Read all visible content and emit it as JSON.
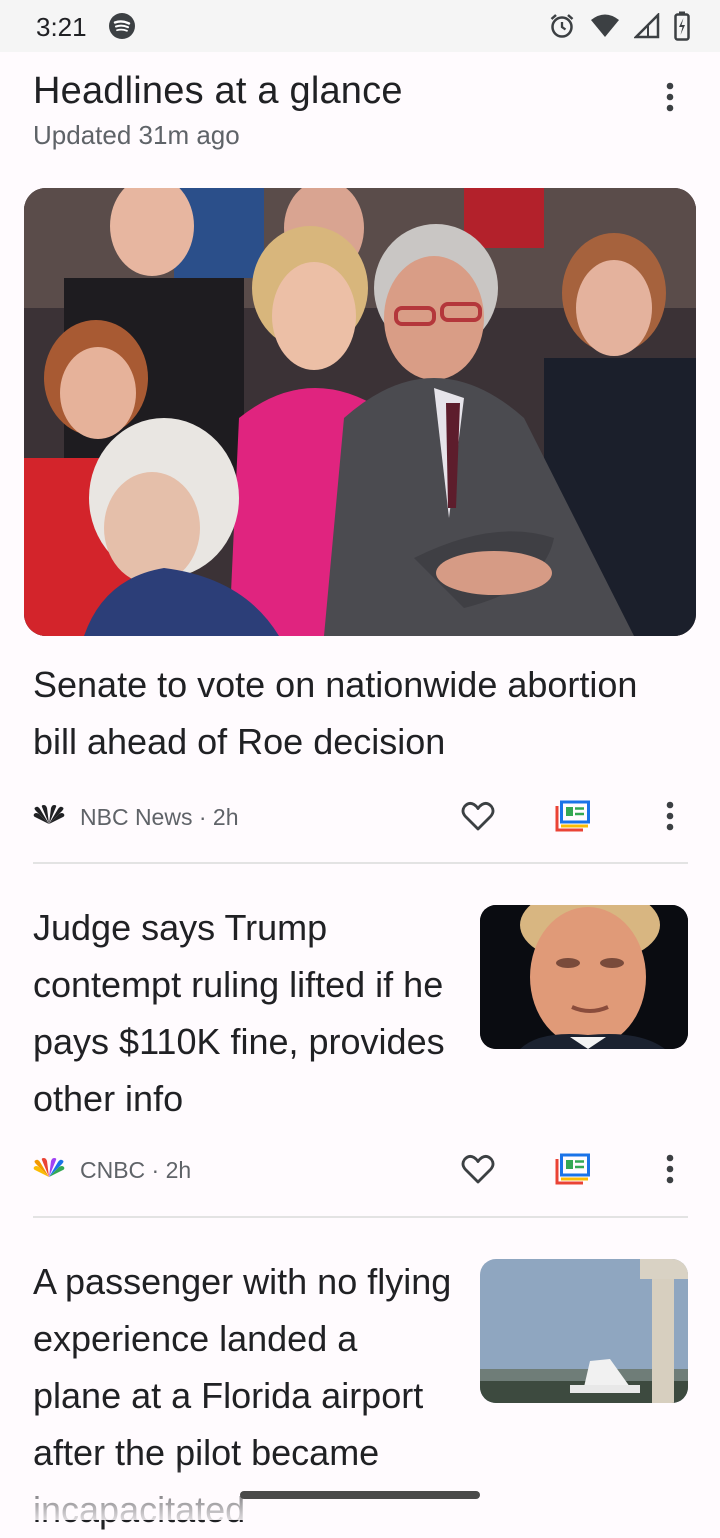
{
  "status_bar": {
    "time": "3:21",
    "icons": [
      "spotify-icon",
      "alarm-icon",
      "wifi-icon",
      "signal-icon",
      "battery-icon"
    ]
  },
  "header": {
    "title": "Headlines at a glance",
    "updated": "Updated 31m ago",
    "menu_icon": "more-vert-icon"
  },
  "stories": [
    {
      "headline": "Senate to vote on nationwide abortion bill ahead of Roe decision",
      "source": "NBC News",
      "age": "2h",
      "meta": "NBC News · 2h",
      "image": "hero-photo"
    },
    {
      "headline": "Judge says Trump contempt ruling lifted if he pays $110K fine, provides other info",
      "source": "CNBC",
      "age": "2h",
      "meta": "CNBC · 2h",
      "image": "thumbnail-photo"
    },
    {
      "headline": "A passenger with no flying experience landed a plane at a Florida airport after the pilot became incapacitated",
      "image": "thumbnail-photo"
    }
  ],
  "actions": {
    "like_icon": "heart-outline-icon",
    "full_coverage_icon": "full-coverage-icon",
    "more_icon": "more-vert-icon"
  },
  "colors": {
    "background": "#fffbfe",
    "text": "#202124",
    "secondary": "#5f6368",
    "divider": "#e3e3e3"
  }
}
